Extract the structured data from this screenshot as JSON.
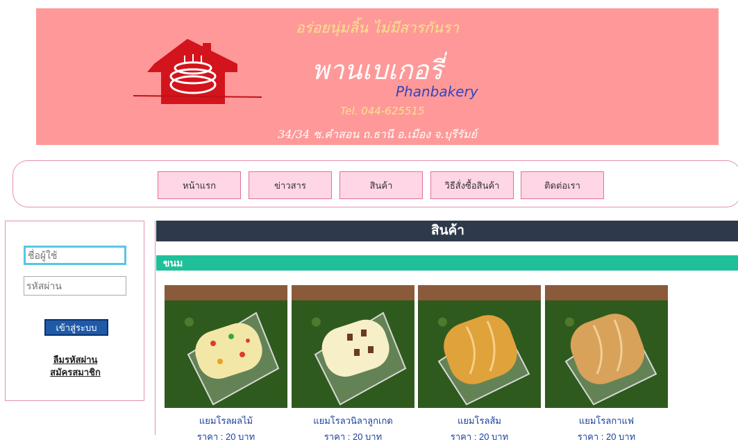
{
  "banner": {
    "tagline": "อร่อยนุ่มลิ้น ไม่มีสารกันรา",
    "title": "พานเบเกอรี่",
    "english_name": "Phanbakery",
    "tel": "Tel. 044-625515",
    "address": "34/34 ซ.คำสอน ถ.ธานี อ.เมือง จ.บุรีรัมย์",
    "logo_icon": "house-cake-logo"
  },
  "nav": {
    "items": [
      {
        "label": "หน้าแรก"
      },
      {
        "label": "ข่าวสาร"
      },
      {
        "label": "สินค้า"
      },
      {
        "label": "วิธีสั่งซื้อสินค้า"
      },
      {
        "label": "ติดต่อเรา"
      }
    ]
  },
  "login": {
    "username_placeholder": "ชื่อผู้ใช้",
    "password_placeholder": "รหัสผ่าน",
    "submit_label": "เข้าสู่ระบบ",
    "forgot_label": "ลืมรหัสผ่าน",
    "register_label": "สมัครสมาชิก"
  },
  "main": {
    "heading": "สินค้า",
    "category": "ขนม",
    "products": [
      {
        "name": "แยมโรลผลไม้",
        "price": "ราคา : 20 บาท",
        "cake_color": "#f3e7a8",
        "variant": "fruit"
      },
      {
        "name": "แยมโรลวนิลาลูกเกด",
        "price": "ราคา : 20 บาท",
        "cake_color": "#f6efc8",
        "variant": "raisin"
      },
      {
        "name": "แยมโรลส้ม",
        "price": "ราคา : 20 บาท",
        "cake_color": "#e0a23a",
        "variant": "orange"
      },
      {
        "name": "แยมโรลกาแฟ",
        "price": "ราคา : 20 บาท",
        "cake_color": "#d9a25a",
        "variant": "coffee"
      }
    ]
  },
  "colors": {
    "banner_bg": "#ff9999",
    "nav_button_bg": "#ffd6e5",
    "header_bar": "#2e3a4c",
    "category_bar": "#1fbf99",
    "link_blue": "#1b3fa0"
  }
}
